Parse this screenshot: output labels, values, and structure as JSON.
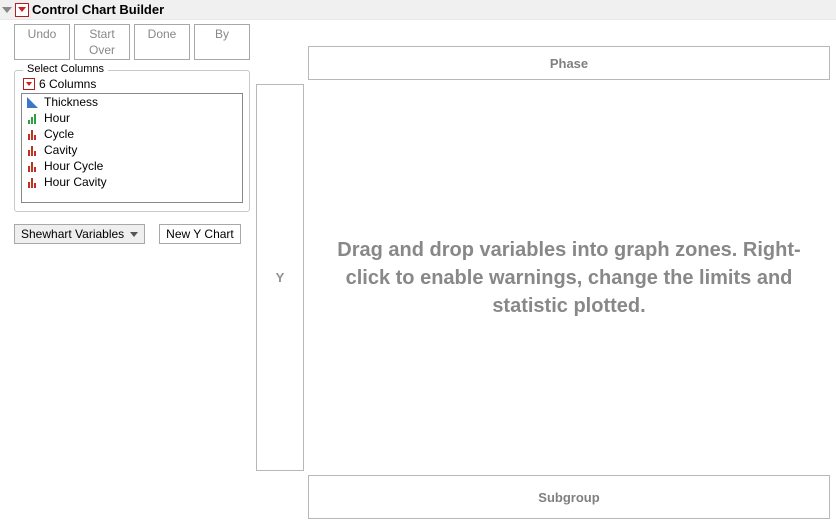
{
  "title": "Control Chart Builder",
  "toolbar": {
    "undo": "Undo",
    "start_over": "Start Over",
    "done": "Done",
    "by": "By"
  },
  "columns_panel": {
    "legend": "Select Columns",
    "count_label": "6 Columns",
    "columns": [
      {
        "name": "Thickness",
        "type": "continuous"
      },
      {
        "name": "Hour",
        "type": "ordinal"
      },
      {
        "name": "Cycle",
        "type": "nominal"
      },
      {
        "name": "Cavity",
        "type": "nominal"
      },
      {
        "name": "Hour Cycle",
        "type": "nominal"
      },
      {
        "name": "Hour Cavity",
        "type": "nominal"
      }
    ]
  },
  "chart_type_select": {
    "value": "Shewhart Variables"
  },
  "new_y_chart_label": "New Y Chart",
  "zones": {
    "phase": "Phase",
    "y": "Y",
    "subgroup": "Subgroup"
  },
  "canvas_hint": "Drag and drop variables into graph zones. Right-click to enable warnings, change the limits and statistic plotted."
}
